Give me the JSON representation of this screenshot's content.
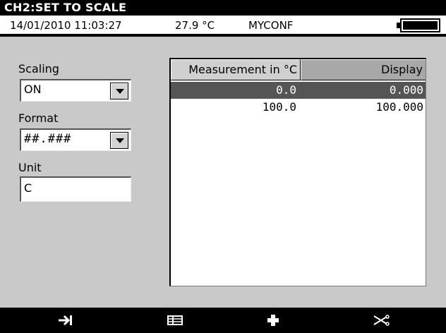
{
  "title": "CH2:SET TO SCALE",
  "status": {
    "datetime": "14/01/2010 11:03:27",
    "temperature": "27.9 °C",
    "config": "MYCONF",
    "battery_level": 1.0
  },
  "form": {
    "scaling_label": "Scaling",
    "scaling_value": "ON",
    "format_label": "Format",
    "format_value": "##.###",
    "unit_label": "Unit",
    "unit_value": "C"
  },
  "table": {
    "columns": [
      "Measurement in  °C",
      "Display"
    ],
    "rows": [
      {
        "measurement": "0.0",
        "display": "0.000",
        "selected": true
      },
      {
        "measurement": "100.0",
        "display": "100.000",
        "selected": false
      }
    ]
  },
  "softkeys": [
    {
      "icon": "tab-arrow-icon"
    },
    {
      "icon": "table-icon"
    },
    {
      "icon": "plus-icon"
    },
    {
      "icon": "delete-scissors-icon"
    }
  ]
}
